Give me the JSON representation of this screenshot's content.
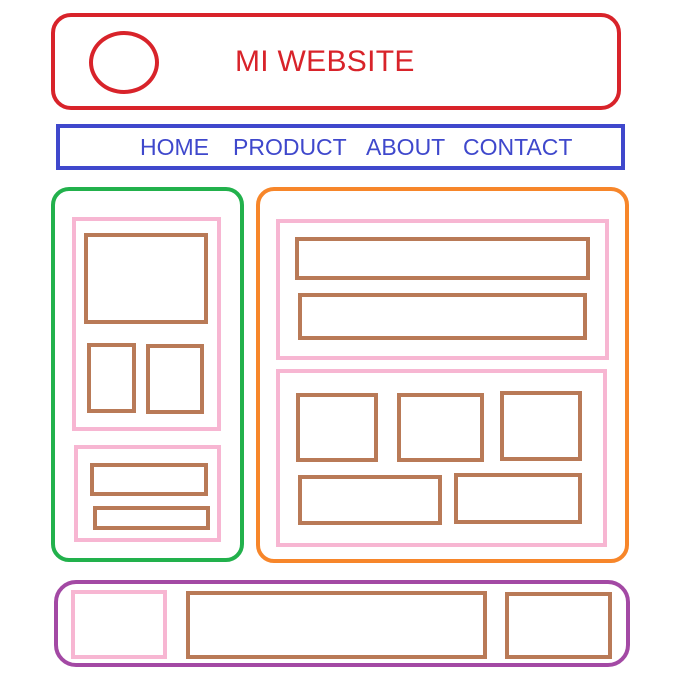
{
  "header": {
    "site_title": "MI WEBSITE"
  },
  "nav": {
    "items": [
      {
        "label": "HOME"
      },
      {
        "label": "PRODUCT"
      },
      {
        "label": "ABOUT"
      },
      {
        "label": "CONTACT"
      }
    ]
  },
  "colors": {
    "header": "#d8232a",
    "nav": "#3f48cc",
    "sidebar": "#22b14c",
    "main": "#f7862a",
    "footer": "#a349a4",
    "section": "#f7b6d2",
    "block": "#b97a57"
  }
}
